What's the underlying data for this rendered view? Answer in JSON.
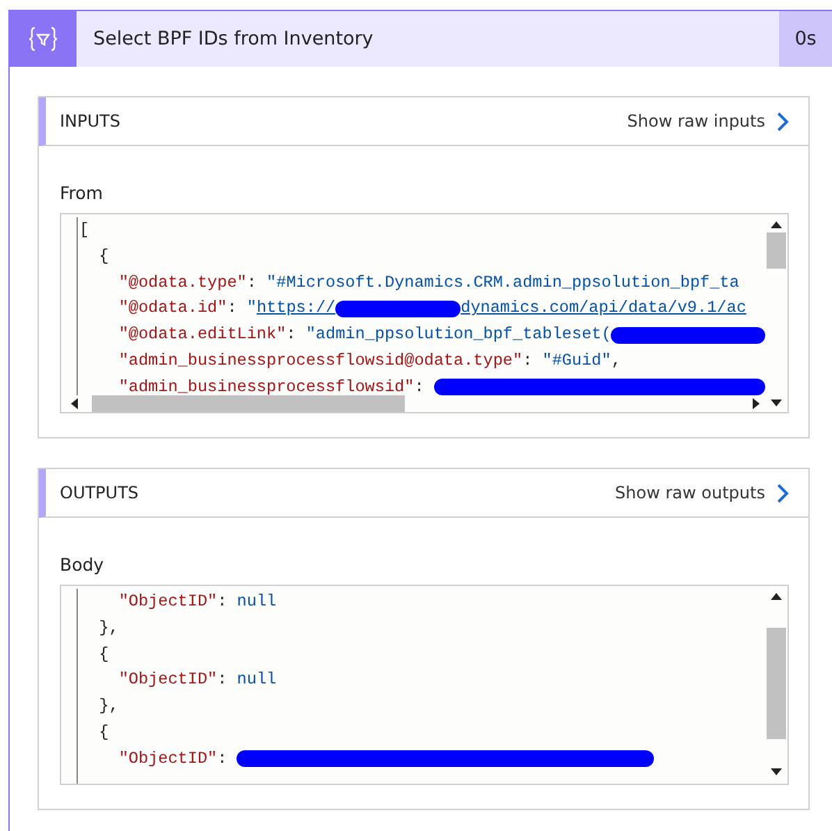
{
  "action": {
    "title": "Select BPF IDs from Inventory",
    "duration": "0s"
  },
  "sections": [
    {
      "title": "INPUTS",
      "link": "Show raw inputs",
      "field": "From",
      "hscroll": true,
      "lines": [
        [
          {
            "kind": "punct",
            "text": "["
          }
        ],
        [
          {
            "kind": "punct",
            "text": "  {"
          }
        ],
        [
          {
            "kind": "key",
            "text": "    \"@odata.type\""
          },
          {
            "kind": "punct",
            "text": ": "
          },
          {
            "kind": "string",
            "text": "\"#Microsoft.Dynamics.CRM.admin_ppsolution_bpf_ta"
          }
        ],
        [
          {
            "kind": "key",
            "text": "    \"@odata.id\""
          },
          {
            "kind": "punct",
            "text": ": "
          },
          {
            "kind": "string",
            "text": "\""
          },
          {
            "kind": "link",
            "text": "https://"
          },
          {
            "kind": "redacted"
          },
          {
            "kind": "link",
            "text": "dynamics.com/api/data/v9.1/ac"
          }
        ],
        [
          {
            "kind": "key",
            "text": "    \"@odata.editLink\""
          },
          {
            "kind": "punct",
            "text": ": "
          },
          {
            "kind": "string",
            "text": "\"admin_ppsolution_bpf_tableset("
          },
          {
            "kind": "redacted"
          }
        ],
        [
          {
            "kind": "key",
            "text": "    \"admin_businessprocessflowsid@odata.type\""
          },
          {
            "kind": "punct",
            "text": ": "
          },
          {
            "kind": "string",
            "text": "\"#Guid\""
          },
          {
            "kind": "punct",
            "text": ","
          }
        ],
        [
          {
            "kind": "key",
            "text": "    \"admin_businessprocessflowsid\""
          },
          {
            "kind": "punct",
            "text": ": "
          },
          {
            "kind": "redacted"
          }
        ]
      ]
    },
    {
      "title": "OUTPUTS",
      "link": "Show raw outputs",
      "field": "Body",
      "hscroll": false,
      "lines": [
        [
          {
            "kind": "key",
            "text": "    \"ObjectID\""
          },
          {
            "kind": "punct",
            "text": ": "
          },
          {
            "kind": "null",
            "text": "null"
          }
        ],
        [
          {
            "kind": "punct",
            "text": "  },"
          }
        ],
        [
          {
            "kind": "punct",
            "text": "  {"
          }
        ],
        [
          {
            "kind": "key",
            "text": "    \"ObjectID\""
          },
          {
            "kind": "punct",
            "text": ": "
          },
          {
            "kind": "null",
            "text": "null"
          }
        ],
        [
          {
            "kind": "punct",
            "text": "  },"
          }
        ],
        [
          {
            "kind": "punct",
            "text": "  {"
          }
        ],
        [
          {
            "kind": "key",
            "text": "    \"ObjectID\""
          },
          {
            "kind": "punct",
            "text": ": "
          },
          {
            "kind": "redacted"
          }
        ]
      ]
    }
  ]
}
